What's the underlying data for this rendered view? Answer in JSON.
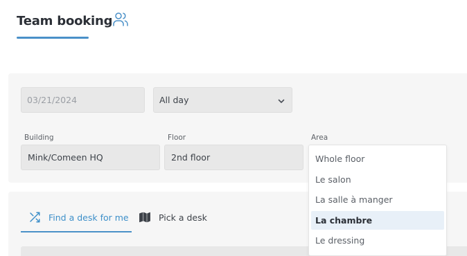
{
  "header": {
    "title": "Team booking",
    "icon": "team-icon",
    "accent_color": "#4a90c8"
  },
  "filters": {
    "date": "03/21/2024",
    "time_select": "All day",
    "building": {
      "label": "Building",
      "value": "Mink/Comeen HQ"
    },
    "floor": {
      "label": "Floor",
      "value": "2nd floor"
    },
    "area": {
      "label": "Area",
      "options": [
        "Whole floor",
        "Le salon",
        "La salle à manger",
        "La chambre",
        "Le dressing"
      ],
      "highlighted": "La chambre"
    }
  },
  "tabs": [
    {
      "label": "Find a desk for me",
      "icon": "shuffle-icon",
      "active": true
    },
    {
      "label": "Pick a desk",
      "icon": "map-icon",
      "active": false
    }
  ]
}
